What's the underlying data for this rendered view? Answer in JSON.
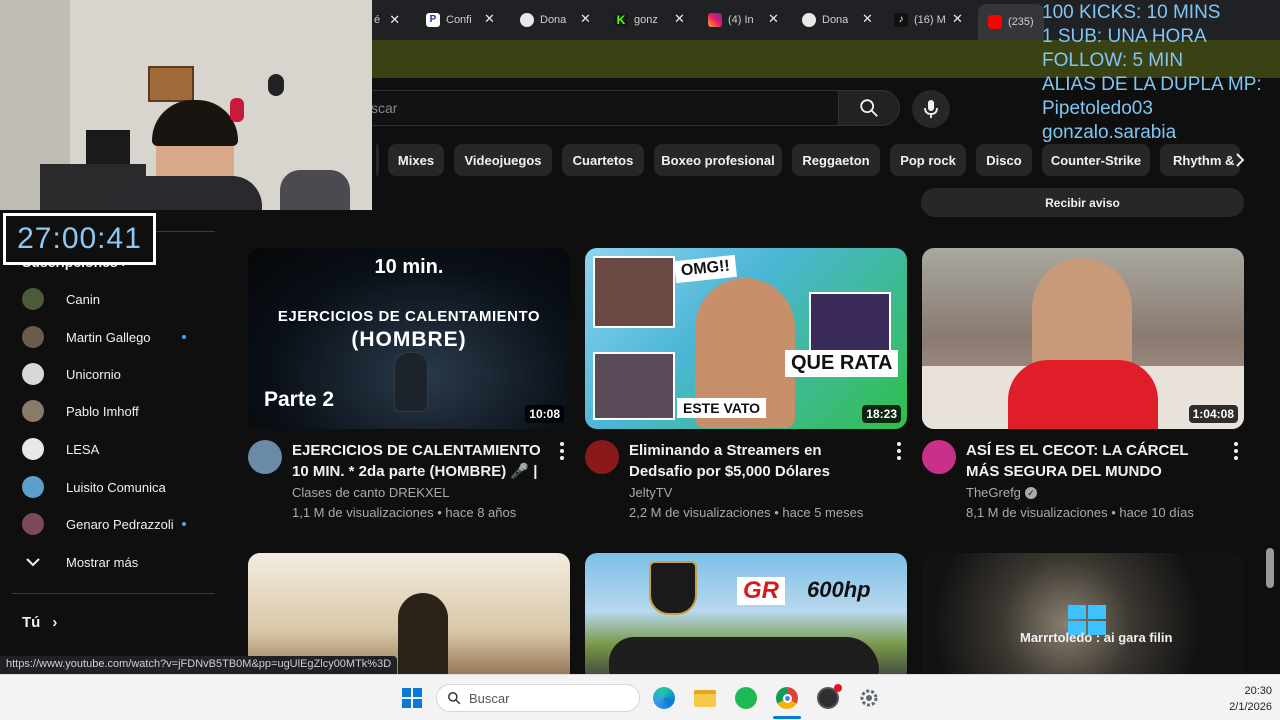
{
  "browser": {
    "tabs": [
      {
        "label": "é",
        "icon": "generic-tab-icon"
      },
      {
        "label": "Confi",
        "icon": "paypal-icon"
      },
      {
        "label": "Dona",
        "icon": "donation-icon"
      },
      {
        "label": "gonz",
        "icon": "kick-icon"
      },
      {
        "label": "(4) In",
        "icon": "instagram-icon"
      },
      {
        "label": "Dona",
        "icon": "donation-icon"
      },
      {
        "label": "(16) M",
        "icon": "tiktok-icon"
      },
      {
        "label": "(235)",
        "icon": "youtube-icon"
      }
    ]
  },
  "youtube": {
    "search_placeholder": "scar",
    "chips": [
      "Mixes",
      "Videojuegos",
      "Cuartetos",
      "Boxeo profesional",
      "Reggaeton",
      "Pop rock",
      "Disco",
      "Counter-Strike",
      "Rhythm &"
    ],
    "notify_label": "Recibir aviso",
    "sidebar": {
      "subscriptions_heading": "Suscripciones",
      "subscriptions": [
        {
          "name": "Canin",
          "dot": false,
          "color": "#4a5a3a"
        },
        {
          "name": "Martin Gallego",
          "dot": true,
          "color": "#6b5b4b"
        },
        {
          "name": "Unicornio",
          "dot": false,
          "color": "#d8d8d8"
        },
        {
          "name": "Pablo Imhoff",
          "dot": false,
          "color": "#8a7a6a"
        },
        {
          "name": "LESA",
          "dot": false,
          "color": "#e8e8e8"
        },
        {
          "name": "Luisito Comunica",
          "dot": false,
          "color": "#5aa0c8"
        },
        {
          "name": "Genaro Pedrazzoli",
          "dot": true,
          "color": "#7a4a5a"
        }
      ],
      "show_more": "Mostrar más",
      "you": "Tú"
    },
    "videos": [
      {
        "title": "EJERCICIOS DE CALENTAMIENTO 10 MIN. * 2da parte (HOMBRE) 🎤 | ...",
        "channel": "Clases de canto DREKXEL",
        "verified": false,
        "meta": "1,1 M de visualizaciones • hace 8 años",
        "duration": "10:08",
        "thumb_top": "10 min.",
        "thumb_mid1": "EJERCICIOS DE CALENTAMIENTO",
        "thumb_mid2": "(HOMBRE)",
        "thumb_bottom": "Parte 2"
      },
      {
        "title": "Eliminando a Streamers en Dedsafio por $5,000 Dólares",
        "channel": "JeltyTV",
        "verified": false,
        "meta": "2,2 M de visualizaciones • hace 5 meses",
        "duration": "18:23",
        "thumb_omg": "OMG!!",
        "thumb_rata": "QUE RATA",
        "thumb_vato": "ESTE VATO"
      },
      {
        "title": "ASÍ ES EL CECOT: LA CÁRCEL MÁS SEGURA DEL MUNDO",
        "channel": "TheGrefg",
        "verified": true,
        "meta": "8,1 M de visualizaciones • hace 10 días",
        "duration": "1:04:08"
      }
    ],
    "row2": {
      "thumb2_gr": "GR",
      "thumb2_hp": "600hp"
    }
  },
  "stream": {
    "timer": "27:00:41",
    "overlay_lines": [
      "100 KICKS: 10 MINS",
      "1 SUB: UNA HORA",
      "FOLLOW: 5 MIN",
      "ALIAS DE LA DUPLA MP:",
      "Pipetoledo03",
      "gonzalo.sarabia"
    ],
    "chat_message": "Marrrtoledo : ai gara filin"
  },
  "status_url": "https://www.youtube.com/watch?v=jFDNvB5TB0M&pp=ugUlEgZlcy00MTk%3D",
  "taskbar": {
    "search_label": "Buscar",
    "time": "20:30",
    "date": "2/1/2026"
  }
}
